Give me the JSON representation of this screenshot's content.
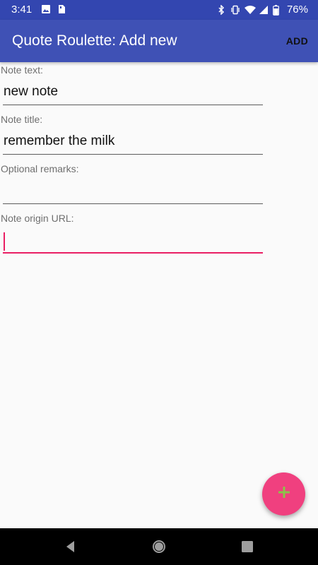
{
  "status_bar": {
    "time": "3:41",
    "battery": "76%",
    "left_icons": [
      "image-icon",
      "sim-card-icon"
    ],
    "right_icons": [
      "bluetooth-icon",
      "vibrate-icon",
      "wifi-icon",
      "signal-icon",
      "battery-icon"
    ]
  },
  "app_bar": {
    "title": "Quote Roulette: Add new",
    "action_label": "ADD"
  },
  "form": {
    "note_text": {
      "label": "Note text:",
      "value": "new note"
    },
    "note_title": {
      "label": "Note title:",
      "value": "remember the milk"
    },
    "remarks": {
      "label": "Optional remarks:",
      "value": ""
    },
    "origin_url": {
      "label": "Note origin URL:",
      "value": ""
    }
  },
  "fab": {
    "icon": "plus-icon"
  },
  "nav_bar": {
    "buttons": [
      "back-icon",
      "home-icon",
      "recents-icon"
    ]
  },
  "colors": {
    "status_bar": "#3346b0",
    "app_bar": "#3f51b5",
    "accent": "#e91e63",
    "fab": "#f0407f",
    "fab_icon": "#8bc34a",
    "background": "#fafafa"
  }
}
